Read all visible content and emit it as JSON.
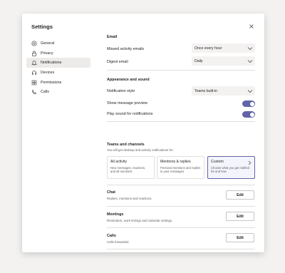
{
  "dialog": {
    "title": "Settings"
  },
  "sidebar": {
    "items": [
      {
        "label": "General",
        "icon": "gear-icon"
      },
      {
        "label": "Privacy",
        "icon": "lock-icon"
      },
      {
        "label": "Notifications",
        "icon": "bell-icon"
      },
      {
        "label": "Devices",
        "icon": "headset-icon"
      },
      {
        "label": "Permissions",
        "icon": "grid-icon"
      },
      {
        "label": "Calls",
        "icon": "phone-icon"
      }
    ],
    "active": "Notifications"
  },
  "email": {
    "heading": "Email",
    "missed_label": "Missed activity emails",
    "missed_value": "Once every hour",
    "digest_label": "Digest email",
    "digest_value": "Daily"
  },
  "appearance": {
    "heading": "Appearance and sound",
    "style_label": "Notification style",
    "style_value": "Teams built-in",
    "preview_label": "Show message preview",
    "preview_on": true,
    "sound_label": "Play sound for notifications",
    "sound_on": true
  },
  "teams": {
    "heading": "Teams and channels",
    "subtitle": "You will get desktop and activity notifications for:",
    "cards": [
      {
        "title": "All activity",
        "desc": "New messages, reactions, and all mentions"
      },
      {
        "title": "Mentions & replies",
        "desc": "Personal mentions and replies to your messages"
      },
      {
        "title": "Custom",
        "desc": "Choose what you get notified for and how"
      }
    ],
    "selected": "Custom"
  },
  "chat": {
    "title": "Chat",
    "desc": "Replies, mentions and reactions.",
    "button": "Edit"
  },
  "meetings": {
    "title": "Meetings",
    "desc": "Reminders, work timings and calendar settings.",
    "button": "Edit"
  },
  "calls": {
    "title": "Calls",
    "desc": "Calls forwarded",
    "button": "Edit"
  },
  "colors": {
    "accent": "#6264a7",
    "background": "#f3f2f1",
    "selected_nav": "#edebe9"
  }
}
